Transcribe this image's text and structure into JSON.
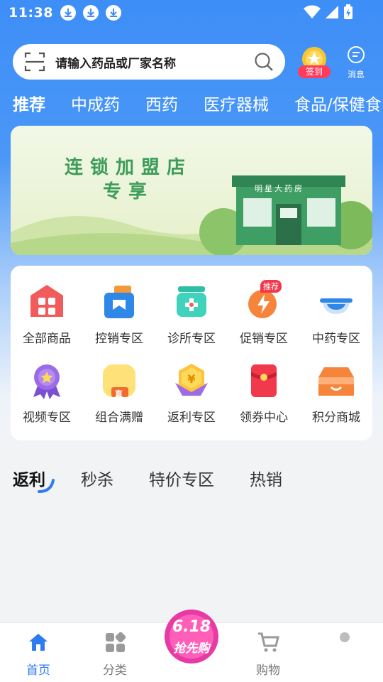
{
  "status_bar": {
    "time": "11:38"
  },
  "search": {
    "placeholder": "请输入药品或厂家名称"
  },
  "header": {
    "checkin_label": "签到",
    "message_label": "消息"
  },
  "category_tabs": [
    {
      "label": "推荐",
      "active": true
    },
    {
      "label": "中成药",
      "active": false
    },
    {
      "label": "西药",
      "active": false
    },
    {
      "label": "医疗器械",
      "active": false
    },
    {
      "label": "食品/保健食",
      "active": false
    }
  ],
  "banner": {
    "title_line1": "连锁加盟店",
    "title_line2": "专享",
    "store_sign": "明星大药房"
  },
  "icon_grid": [
    {
      "label": "全部商品",
      "icon": "all-goods-icon"
    },
    {
      "label": "控销专区",
      "icon": "controlled-sales-icon"
    },
    {
      "label": "诊所专区",
      "icon": "clinic-icon"
    },
    {
      "label": "促销专区",
      "icon": "promotion-icon",
      "badge": "推荐"
    },
    {
      "label": "中药专区",
      "icon": "chinese-medicine-bowl-icon"
    },
    {
      "label": "视频专区",
      "icon": "video-medal-icon"
    },
    {
      "label": "组合满赠",
      "icon": "combo-gift-icon",
      "badge": "直"
    },
    {
      "label": "返利专区",
      "icon": "rebate-yen-icon"
    },
    {
      "label": "领券中心",
      "icon": "coupon-envelope-icon"
    },
    {
      "label": "积分商城",
      "icon": "points-shop-icon"
    }
  ],
  "section_tabs": [
    {
      "label": "返利",
      "active": true
    },
    {
      "label": "秒杀",
      "active": false
    },
    {
      "label": "特价专区",
      "active": false
    },
    {
      "label": "热销",
      "active": false
    }
  ],
  "bottom_nav": [
    {
      "label": "首页",
      "active": true,
      "icon": "home-icon"
    },
    {
      "label": "分类",
      "active": false,
      "icon": "category-icon"
    },
    {
      "label": "购物",
      "active": false,
      "icon": "cart-icon"
    },
    {
      "label": "",
      "active": false,
      "icon": "profile-icon"
    }
  ],
  "promo_badge": {
    "line1": "6.18",
    "line2": "抢先购"
  },
  "colors": {
    "primary": "#3d8ef7",
    "accent_red": "#ff3b5c",
    "nav_active": "#2f7bf1"
  }
}
